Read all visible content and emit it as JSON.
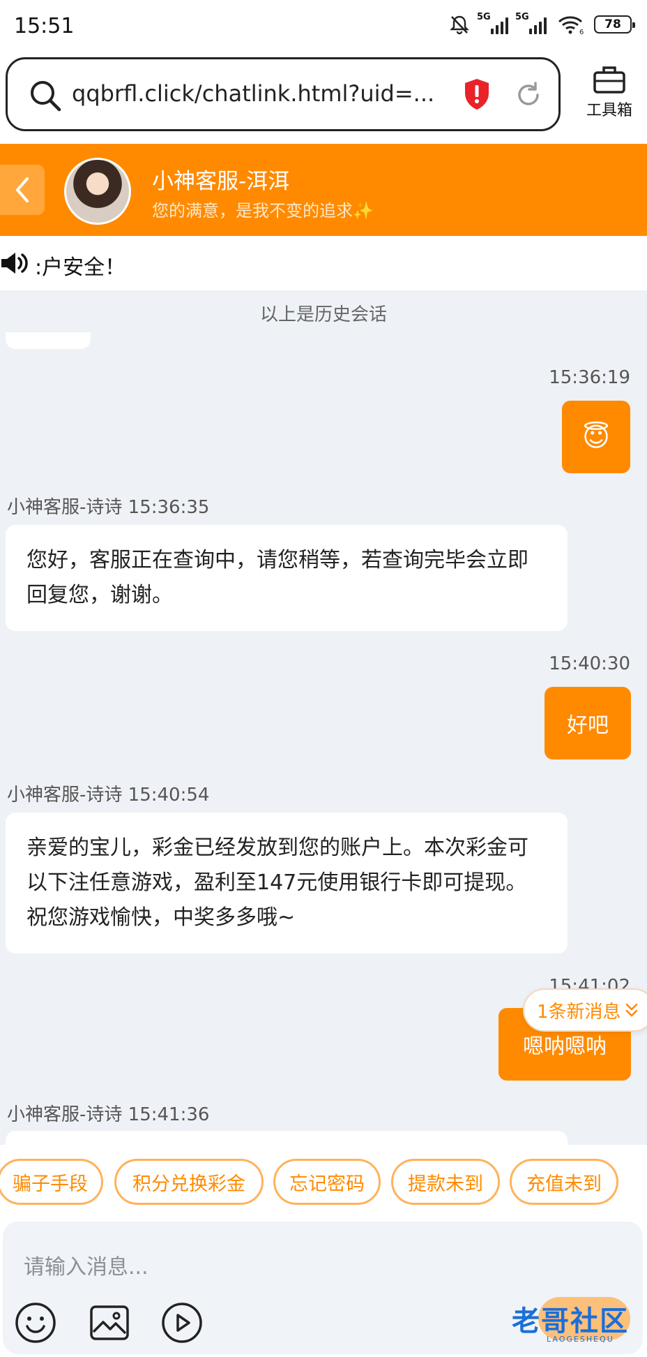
{
  "status_bar": {
    "time": "15:51",
    "sim1": "5G",
    "sim2": "5G",
    "wifi_badge": "6",
    "battery": "78"
  },
  "browser": {
    "url": "qqbrfl.click/chatlink.html?uid=...",
    "toolbox_label": "工具箱"
  },
  "header": {
    "agent_name": "小神客服-洱洱",
    "agent_subtitle": "您的满意，是我不变的追求✨"
  },
  "notice": {
    "text": ":户安全！"
  },
  "chat": {
    "history_label": "以上是历史会话",
    "messages": [
      {
        "side": "right",
        "time": "15:36:19",
        "text": "😇"
      },
      {
        "side": "left",
        "meta": "小神客服-诗诗 15:36:35",
        "text": "您好，客服正在查询中，请您稍等，若查询完毕会立即回复您，谢谢。"
      },
      {
        "side": "right",
        "time": "15:40:30",
        "text": "好吧"
      },
      {
        "side": "left",
        "meta": "小神客服-诗诗 15:40:54",
        "text": "亲爱的宝儿，彩金已经发放到您的账户上。本次彩金可以下注任意游戏，盈利至147元使用银行卡即可提现。祝您游戏愉快，中奖多多哦~"
      },
      {
        "side": "right",
        "time": "15:41:02",
        "text": "嗯呐嗯呐"
      },
      {
        "side": "left",
        "meta": "小神客服-诗诗 15:41:36",
        "text": ""
      }
    ],
    "new_message_pill": "1条新消息"
  },
  "quick_replies": [
    "骗子手段",
    "积分兑换彩金",
    "忘记密码",
    "提款未到",
    "充值未到"
  ],
  "input": {
    "placeholder": "请输入消息..."
  },
  "watermark": {
    "text": "老哥社区",
    "sub": "LAOGESHEQU"
  },
  "colors": {
    "accent": "#ff8a00",
    "page_bg": "#eef1f6"
  }
}
